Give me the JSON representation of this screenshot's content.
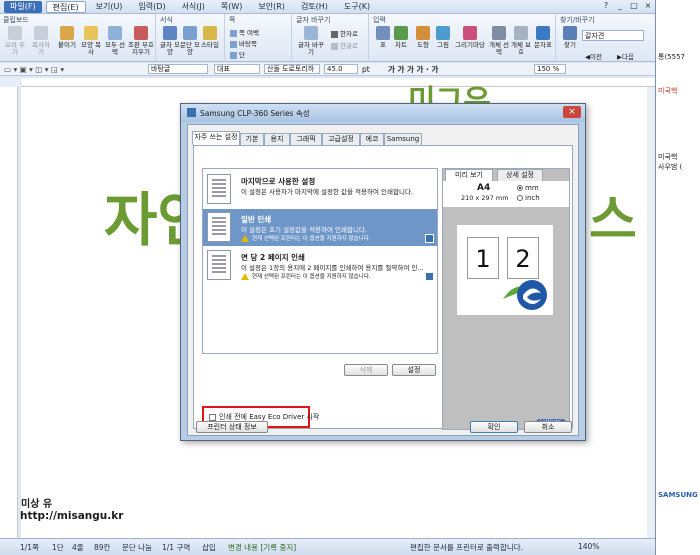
{
  "menubar": {
    "items": [
      "파일(F)",
      "편집(E)",
      "보기(U)",
      "입력(D)",
      "서식(J)",
      "쪽(W)",
      "보안(R)",
      "검토(H)",
      "도구(K)"
    ],
    "window_controls": [
      "?",
      "_",
      "□",
      "×"
    ]
  },
  "ribbon": {
    "groups": {
      "clipboard": "클립보드",
      "format": "서식",
      "page": "쪽",
      "annotation": "글자 바꾸기",
      "insert": "입력",
      "find": "찾기/바꾸기"
    },
    "clipboard_buttons": [
      "오려 두기",
      "복사하기",
      "붙이기",
      "모양 복사",
      "모두 선택",
      "조판 부호 지우기"
    ],
    "format_buttons": [
      "글자 모양",
      "문단 모양",
      "스타일"
    ],
    "page_items": [
      "쪽 여백",
      "바탕쪽",
      "단"
    ],
    "annotation_items": [
      "글자 바꾸기",
      "한자로",
      "한글로"
    ],
    "insert_buttons": [
      "표",
      "차트",
      "도형",
      "그림",
      "그리기마당",
      "개체 선택",
      "개체 보호"
    ],
    "special_char": "문자표",
    "find": "찾기",
    "search_value": "갈자견",
    "nav": [
      "이전",
      "다음"
    ]
  },
  "fmtbar": {
    "style": "바탕글",
    "lang": "대표",
    "font": "산돌 도로토리하",
    "size": "45.0",
    "unit": "pt",
    "styles": "가 가 가 가 · 가",
    "zoom": "150 %"
  },
  "document": {
    "heading_big": "자연",
    "heading_right": "스",
    "heading_top": "미그유",
    "author": "미상 유",
    "url": "http://misangu.kr",
    "tab_label": "감잔"
  },
  "dialog": {
    "title": "Samsung CLP-360 Series 속성",
    "title_controls": [
      "×"
    ],
    "tabs": [
      "자주 쓰는 설정",
      "기본",
      "용지",
      "그래픽",
      "고급설정",
      "에코",
      "Samsung"
    ],
    "favorites": [
      {
        "title": "마지막으로 사용한 설정",
        "desc": "이 설정은 사용자가 마지막에 설정한 값을 적용하여 인쇄합니다.",
        "warn": ""
      },
      {
        "title": "일반 인쇄",
        "desc": "이 설정은 초기 설정값을 적용하여 인쇄합니다.",
        "warn": "현재 선택된 프린터는 이 옵션을 지원하지 않습니다."
      },
      {
        "title": "면 당 2 페이지 인쇄",
        "desc": "이 설정은 1장의 용지에 2 페이지를 인쇄하여 용지를 절약하여 인...",
        "warn": "현재 선택된 프린터는 이 옵션을 지원하지 않습니다."
      }
    ],
    "delete_label": "삭제",
    "settings_label": "설정",
    "eco_label": "인쇄 전에 Easy Eco Driver 시작",
    "preview_tabs": [
      "미리 보기",
      "상세 설정"
    ],
    "paper_size": "A4",
    "paper_dims": "210 x 297 mm",
    "unit_mm": "mm",
    "unit_inch": "inch",
    "page_numbers": [
      "1",
      "2"
    ],
    "brand": "SAMSUNG",
    "printer_status_label": "프린터 상태 정보",
    "ok_label": "확인",
    "cancel_label": "취소"
  },
  "rightwin": {
    "lines": [
      "통(5557",
      "미국핵",
      "미국핵",
      "사우범 (",
      "SAMSUNG"
    ]
  },
  "statusbar": {
    "items": [
      "1/1쪽",
      "1단",
      "4줄",
      "89칸",
      "문단 나눔",
      "1/1 구역",
      "삽입",
      "변경 내용 [기록 중지]",
      "편집한 문서를 프린터로 출력합니다."
    ],
    "zoom": "140%"
  },
  "colors": {
    "accent_green": "#6c9b34",
    "selection_blue": "#6f96c8",
    "highlight_red": "#e01616"
  }
}
